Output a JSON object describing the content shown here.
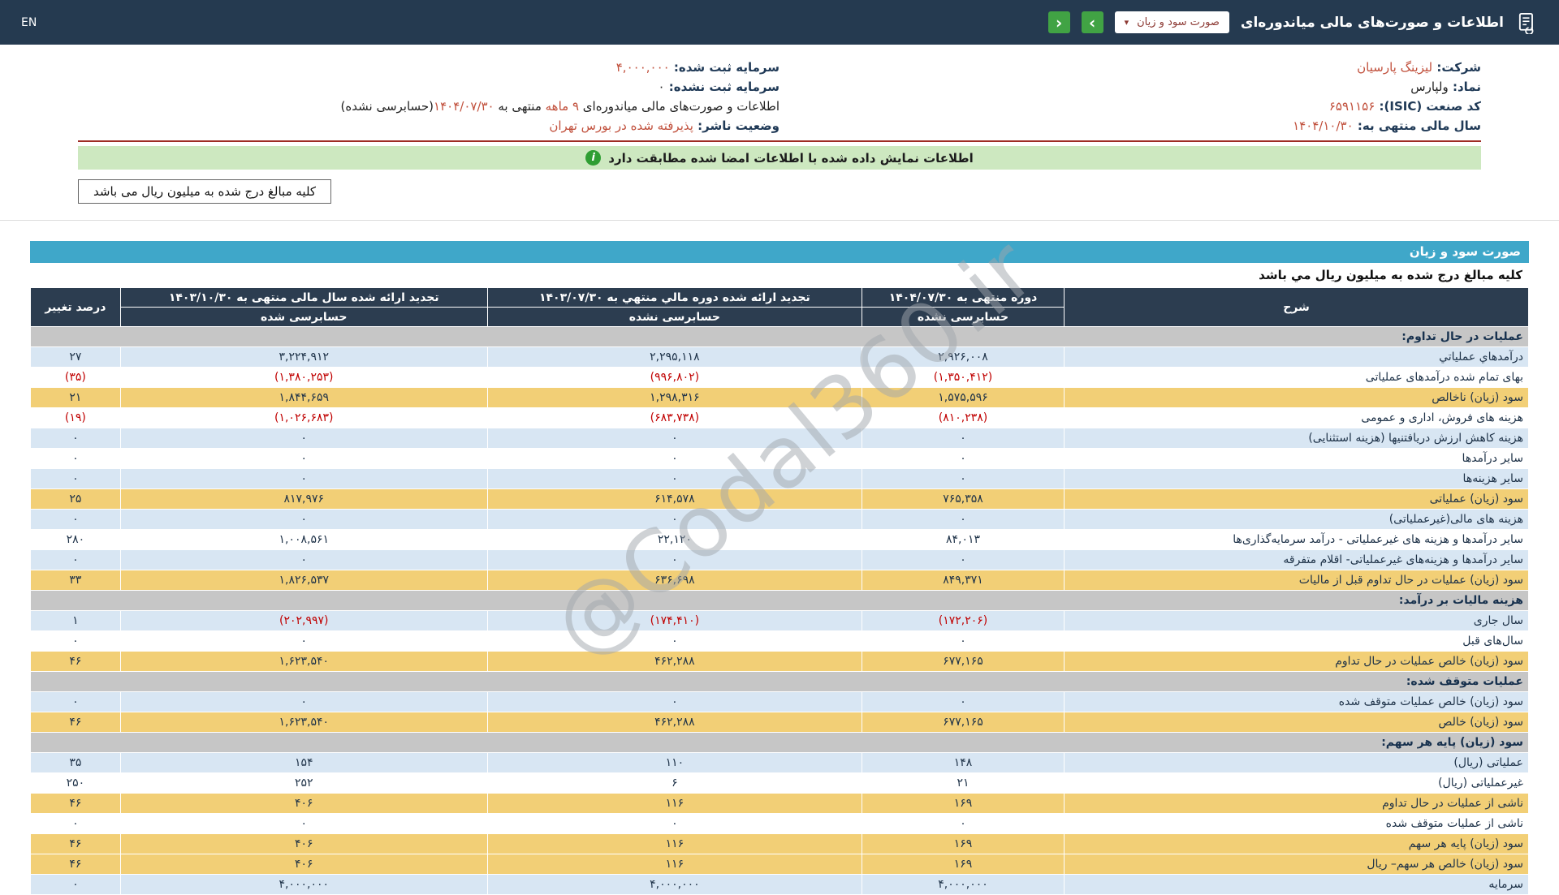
{
  "colors": {
    "topbar_bg": "#253a50",
    "header_bg": "#2c3d50",
    "title_bar_bg": "#3fa7c9",
    "row_blue": "#d8e6f3",
    "row_yellow": "#f2cf76",
    "section_gray": "#c6c6c6",
    "negative_red": "#c00000",
    "accent_red": "#c1503c",
    "green_button": "#41a344",
    "notice_green_bg": "#cde8c0",
    "navy_text": "#203a57"
  },
  "topbar": {
    "en": "EN",
    "title": "اطلاعات و صورت‌های مالی میاندوره‌ای",
    "sheet_select": "صورت سود و زیان",
    "caret": "▾",
    "nav_next": "›",
    "nav_prev": "‹"
  },
  "info": {
    "right_rows": [
      {
        "segments": [
          {
            "t": "شرکت: ",
            "c": "lbl"
          },
          {
            "t": "لیزینگ پارسیان",
            "c": "red"
          }
        ]
      },
      {
        "segments": [
          {
            "t": "نماد: ",
            "c": "lbl"
          },
          {
            "t": "ولپارس",
            "c": "plain"
          }
        ]
      },
      {
        "segments": [
          {
            "t": "کد صنعت (ISIC): ",
            "c": "lbl"
          },
          {
            "t": "۶۵۹۱۱۵۶",
            "c": "red"
          }
        ]
      },
      {
        "segments": [
          {
            "t": "سال مالی منتهی به: ",
            "c": "lbl"
          },
          {
            "t": "۱۴۰۴/۱۰/۳۰",
            "c": "red"
          }
        ]
      }
    ],
    "left_rows": [
      {
        "segments": [
          {
            "t": "سرمایه ثبت شده: ",
            "c": "lbl"
          },
          {
            "t": "۴,۰۰۰,۰۰۰",
            "c": "red"
          }
        ]
      },
      {
        "segments": [
          {
            "t": "سرمایه ثبت نشده: ",
            "c": "lbl"
          },
          {
            "t": "۰",
            "c": "plain"
          }
        ]
      },
      {
        "segments": [
          {
            "t": "اطلاعات و صورت‌های مالی میاندوره‌ای ",
            "c": "plain"
          },
          {
            "t": "۹ ماهه",
            "c": "red"
          },
          {
            "t": " منتهی به ",
            "c": "plain"
          },
          {
            "t": "۱۴۰۴/۰۷/۳۰",
            "c": "red"
          },
          {
            "t": "(حسابرسی نشده)",
            "c": "plain"
          }
        ]
      },
      {
        "segments": [
          {
            "t": "وضعیت ناشر: ",
            "c": "lbl"
          },
          {
            "t": "پذیرفته شده در بورس تهران",
            "c": "red"
          }
        ]
      }
    ],
    "notice_icon_glyph": "i",
    "match_notice": "اطلاعات نمایش داده شده با اطلاعات امضا شده مطابقت دارد",
    "unit_note": "کلیه مبالغ درج شده به میلیون ریال می باشد"
  },
  "statement": {
    "title": "صورت سود و زیان",
    "unit_note": "کلیه مبالغ درج شده به میلیون ريال مي باشد",
    "header": {
      "desc": "شرح",
      "cols": [
        {
          "title": "دوره منتهی به ۱۴۰۴/۰۷/۳۰",
          "sub": "حسابرسی نشده"
        },
        {
          "title": "تجدید ارائه شده دوره مالي منتهي به ۱۴۰۳/۰۷/۳۰",
          "sub": "حسابرسی نشده"
        },
        {
          "title": "تجدید ارائه شده سال مالی منتهی به ۱۴۰۳/۱۰/۳۰",
          "sub": "حسابرسی شده"
        }
      ],
      "change": "درصد تغییر"
    },
    "rows": [
      {
        "type": "section",
        "label": "عملیات در حال تداوم:"
      },
      {
        "type": "data",
        "style": "blue",
        "label": "درآمدهاي عملياتي",
        "values": [
          "۲,۹۲۶,۰۰۸",
          "۲,۲۹۵,۱۱۸",
          "۳,۲۲۴,۹۱۲"
        ],
        "pct": "۲۷"
      },
      {
        "type": "data",
        "style": "white",
        "label": "بهای تمام شده درآمدهای عملیاتی",
        "values": [
          "(۱,۳۵۰,۴۱۲)",
          "(۹۹۶,۸۰۲)",
          "(۱,۳۸۰,۲۵۳)"
        ],
        "pct": "(۳۵)"
      },
      {
        "type": "data",
        "style": "yellow",
        "label": "سود (زيان) ناخالص",
        "values": [
          "۱,۵۷۵,۵۹۶",
          "۱,۲۹۸,۳۱۶",
          "۱,۸۴۴,۶۵۹"
        ],
        "pct": "۲۱"
      },
      {
        "type": "data",
        "style": "white",
        "label": "هزینه های فروش، اداری و عمومی",
        "values": [
          "(۸۱۰,۲۳۸)",
          "(۶۸۳,۷۳۸)",
          "(۱,۰۲۶,۶۸۳)"
        ],
        "pct": "(۱۹)"
      },
      {
        "type": "data",
        "style": "blue",
        "label": "هزینه کاهش ارزش دریافتنیها (هزینه استثنایی)",
        "values": [
          "۰",
          "۰",
          "۰"
        ],
        "pct": "۰"
      },
      {
        "type": "data",
        "style": "white",
        "label": "سایر درآمدها",
        "values": [
          "۰",
          "۰",
          "۰"
        ],
        "pct": "۰"
      },
      {
        "type": "data",
        "style": "blue",
        "label": "سایر هزینه‌ها",
        "values": [
          "۰",
          "۰",
          "۰"
        ],
        "pct": "۰"
      },
      {
        "type": "data",
        "style": "yellow",
        "label": "سود (زيان) عملياتی",
        "values": [
          "۷۶۵,۳۵۸",
          "۶۱۴,۵۷۸",
          "۸۱۷,۹۷۶"
        ],
        "pct": "۲۵"
      },
      {
        "type": "data",
        "style": "blue",
        "label": "هزینه های مالی(غیرعملیاتی)",
        "values": [
          "۰",
          "۰",
          "۰"
        ],
        "pct": "۰"
      },
      {
        "type": "data",
        "style": "white",
        "label": "سایر درآمدها و هزینه های غیرعملیاتی - درآمد سرمایه‌گذاری‌ها",
        "values": [
          "۸۴,۰۱۳",
          "۲۲,۱۲۰",
          "۱,۰۰۸,۵۶۱"
        ],
        "pct": "۲۸۰"
      },
      {
        "type": "data",
        "style": "blue",
        "label": "سایر درآمدها و هزینه‌های غیرعملیاتی- اقلام متفرقه",
        "values": [
          "۰",
          "۰",
          "۰"
        ],
        "pct": "۰"
      },
      {
        "type": "data",
        "style": "yellow",
        "label": "سود (زيان) عملیات در حال تداوم قبل از مالیات",
        "values": [
          "۸۴۹,۳۷۱",
          "۶۳۶,۶۹۸",
          "۱,۸۲۶,۵۳۷"
        ],
        "pct": "۳۳"
      },
      {
        "type": "section",
        "label": "هزینه مالیات بر درآمد:"
      },
      {
        "type": "data",
        "style": "blue",
        "label": "سال جاری",
        "values": [
          "(۱۷۲,۲۰۶)",
          "(۱۷۴,۴۱۰)",
          "(۲۰۲,۹۹۷)"
        ],
        "pct": "۱"
      },
      {
        "type": "data",
        "style": "white",
        "label": "سال‌های قبل",
        "values": [
          "۰",
          "۰",
          "۰"
        ],
        "pct": "۰"
      },
      {
        "type": "data",
        "style": "yellow",
        "label": "سود (زيان) خالص عملیات در حال تداوم",
        "values": [
          "۶۷۷,۱۶۵",
          "۴۶۲,۲۸۸",
          "۱,۶۲۳,۵۴۰"
        ],
        "pct": "۴۶"
      },
      {
        "type": "section",
        "label": "عملیات متوقف شده:"
      },
      {
        "type": "data",
        "style": "blue",
        "label": "سود (زیان) خالص عملیات متوقف شده",
        "values": [
          "۰",
          "۰",
          "۰"
        ],
        "pct": "۰"
      },
      {
        "type": "data",
        "style": "yellow",
        "label": "سود (زيان) خالص",
        "values": [
          "۶۷۷,۱۶۵",
          "۴۶۲,۲۸۸",
          "۱,۶۲۳,۵۴۰"
        ],
        "pct": "۴۶"
      },
      {
        "type": "section",
        "label": "سود (زیان) پایه هر سهم:"
      },
      {
        "type": "data",
        "style": "blue",
        "label": "عملیاتی (ریال)",
        "values": [
          "۱۴۸",
          "۱۱۰",
          "۱۵۴"
        ],
        "pct": "۳۵"
      },
      {
        "type": "data",
        "style": "white",
        "label": "غیرعملیاتی (ریال)",
        "values": [
          "۲۱",
          "۶",
          "۲۵۲"
        ],
        "pct": "۲۵۰"
      },
      {
        "type": "data",
        "style": "yellow",
        "label": "ناشی از عملیات در حال تداوم",
        "values": [
          "۱۶۹",
          "۱۱۶",
          "۴۰۶"
        ],
        "pct": "۴۶"
      },
      {
        "type": "data",
        "style": "white",
        "label": "ناشی از عملیات متوقف شده",
        "values": [
          "۰",
          "۰",
          "۰"
        ],
        "pct": "۰"
      },
      {
        "type": "data",
        "style": "yellow",
        "label": "سود (زیان) پایه هر سهم",
        "values": [
          "۱۶۹",
          "۱۱۶",
          "۴۰۶"
        ],
        "pct": "۴۶"
      },
      {
        "type": "data",
        "style": "yellow",
        "label": "سود (زیان) خالص هر سهم– ریال",
        "values": [
          "۱۶۹",
          "۱۱۶",
          "۴۰۶"
        ],
        "pct": "۴۶"
      },
      {
        "type": "data",
        "style": "blue",
        "label": "سرمایه",
        "values": [
          "۴,۰۰۰,۰۰۰",
          "۴,۰۰۰,۰۰۰",
          "۴,۰۰۰,۰۰۰"
        ],
        "pct": "۰"
      }
    ]
  },
  "watermark": "@Codal360.ir"
}
